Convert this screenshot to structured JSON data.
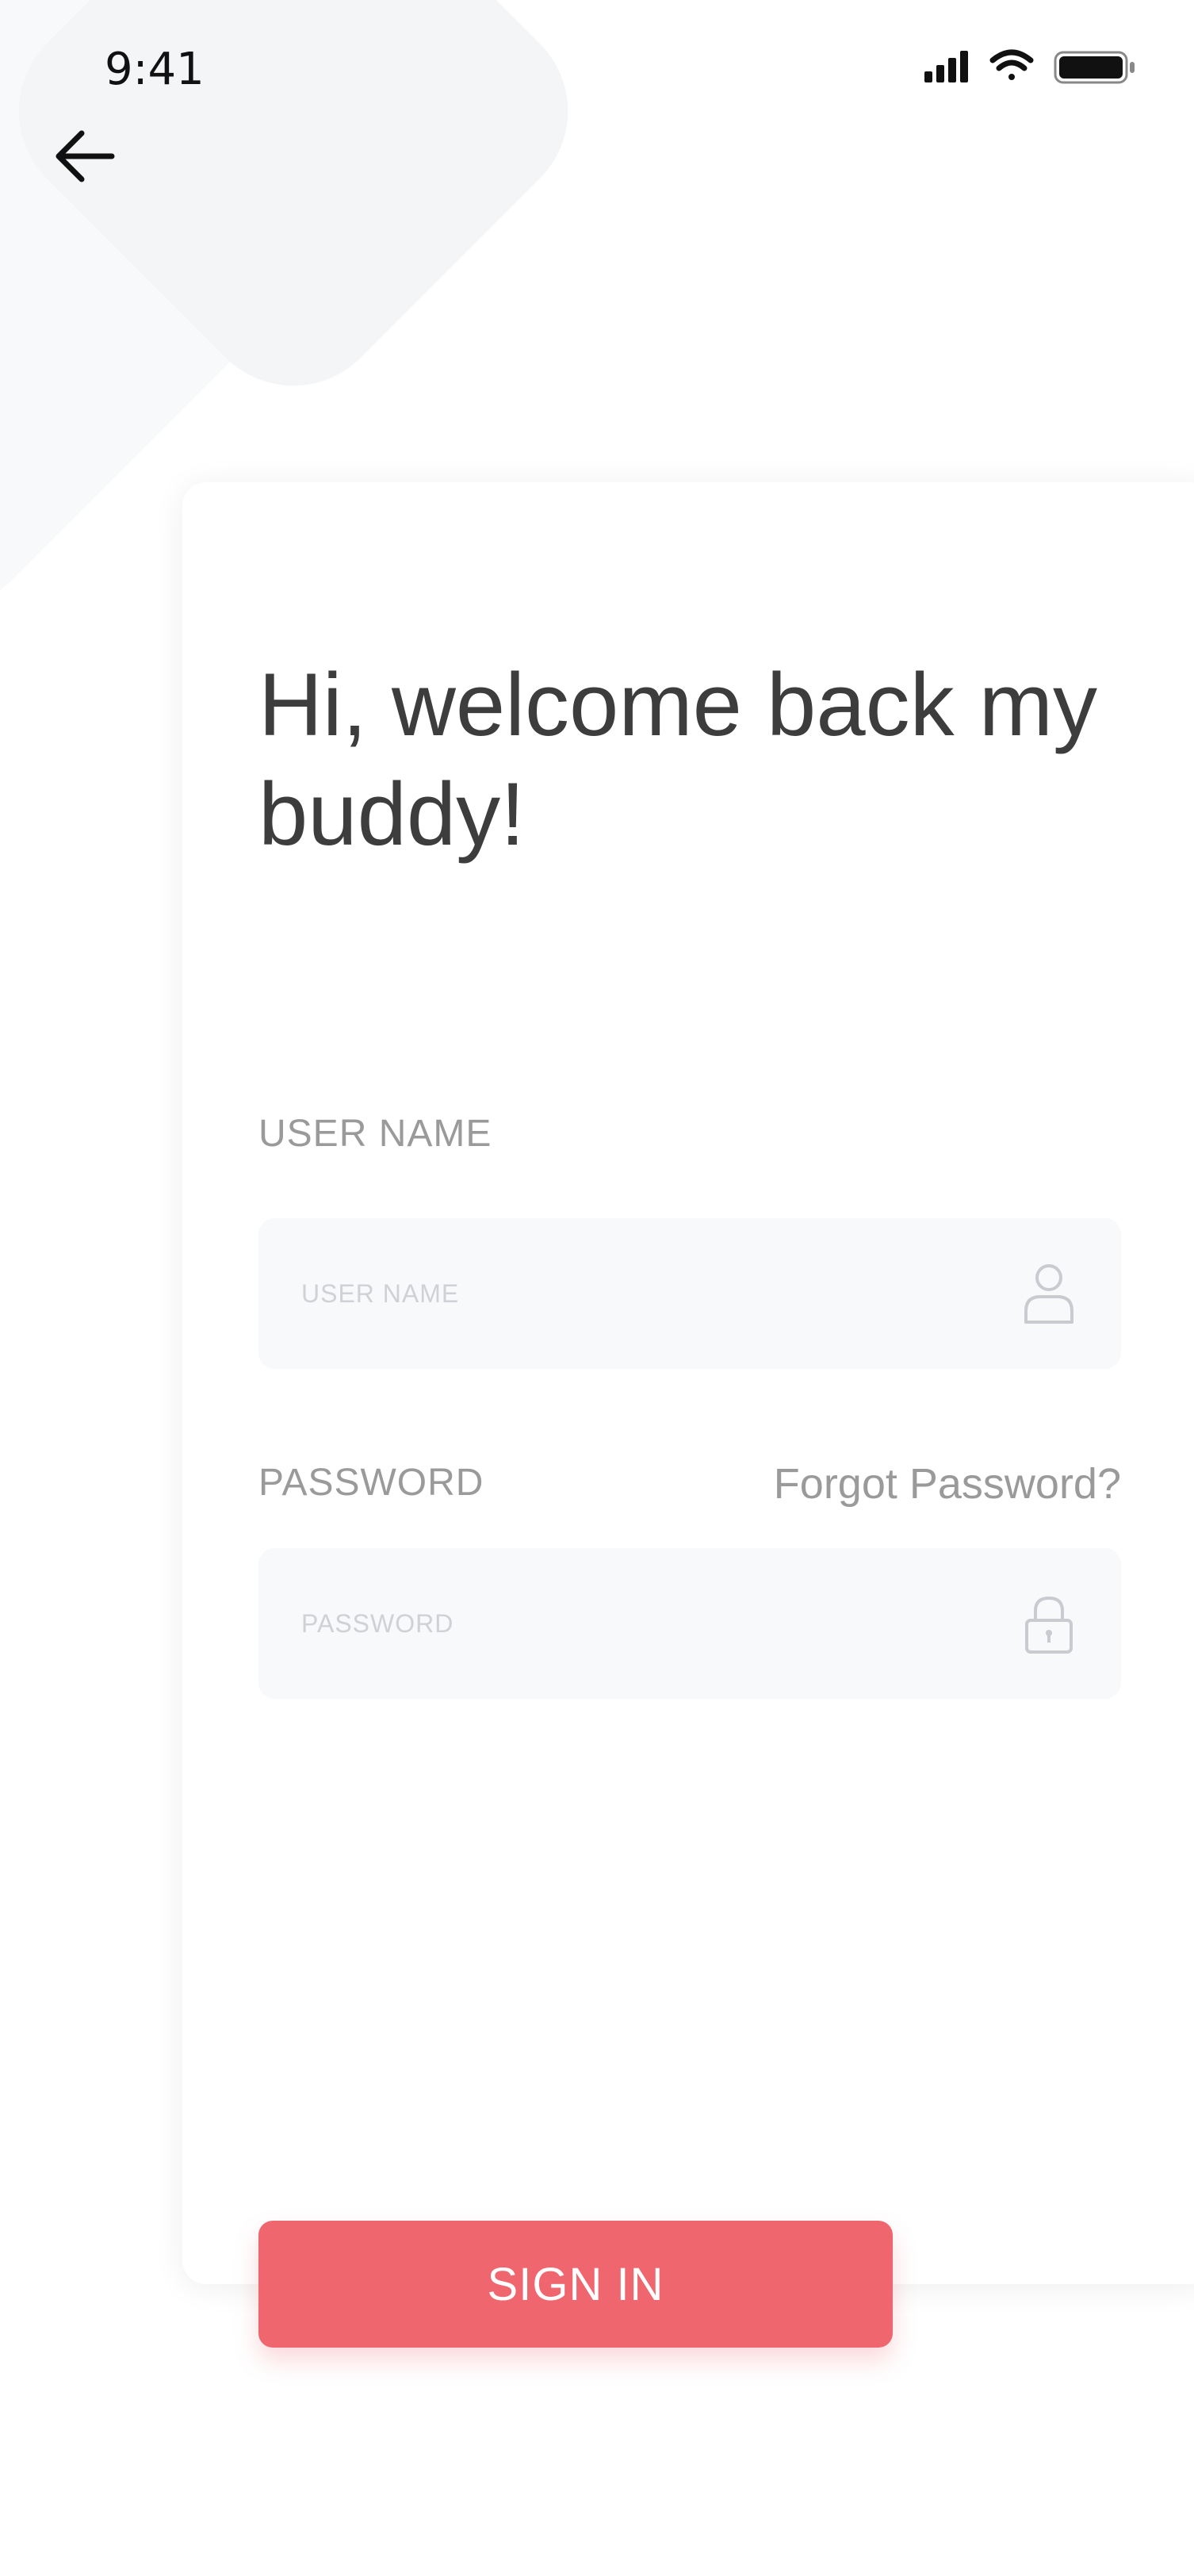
{
  "status_bar": {
    "time": "9:41",
    "icons": [
      "cellular-signal-icon",
      "wifi-icon",
      "battery-icon"
    ]
  },
  "nav": {
    "back_icon": "arrow-left-icon"
  },
  "welcome": {
    "title": "Hi, welcome back my buddy!"
  },
  "form": {
    "username": {
      "label": "USER NAME",
      "placeholder": "USER NAME",
      "value": "",
      "icon": "user-icon"
    },
    "password": {
      "label": "PASSWORD",
      "placeholder": "PASSWORD",
      "value": "",
      "icon": "lock-icon"
    },
    "forgot_password": "Forgot Password?",
    "submit_label": "SIGN IN"
  },
  "colors": {
    "accent": "#F0666F",
    "title_text": "#3D3D3D",
    "label_text": "#9A9A9A",
    "input_background": "#F8F9FB"
  }
}
